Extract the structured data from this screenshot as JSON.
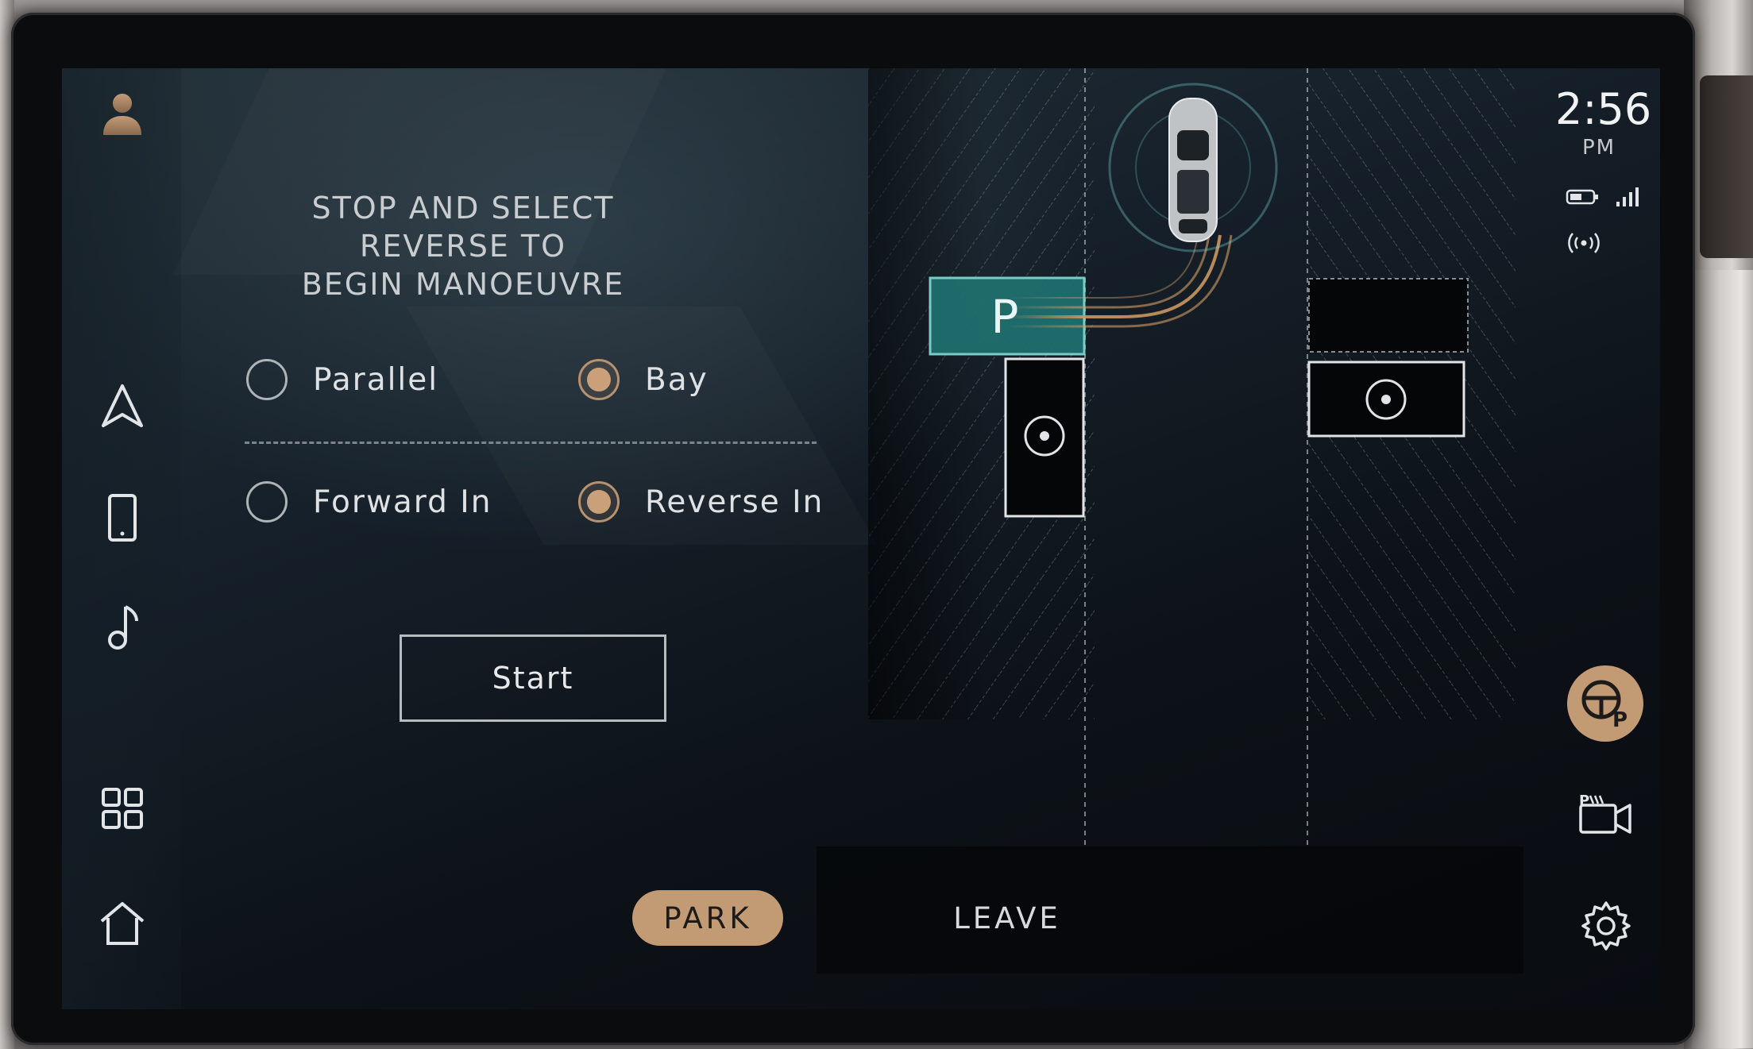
{
  "status": {
    "time": "2:56",
    "ampm": "PM"
  },
  "instruction": {
    "line1": "STOP AND SELECT REVERSE TO",
    "line2": "BEGIN MANOEUVRE"
  },
  "parking_type": {
    "options": [
      {
        "label": "Parallel",
        "selected": false
      },
      {
        "label": "Bay",
        "selected": true
      }
    ]
  },
  "approach": {
    "options": [
      {
        "label": "Forward In",
        "selected": false
      },
      {
        "label": "Reverse In",
        "selected": true
      }
    ]
  },
  "start_label": "Start",
  "tabs": {
    "park": "PARK",
    "leave": "LEAVE"
  },
  "map": {
    "target_label": "P"
  },
  "nav_icons": [
    "user-avatar-icon",
    "navigation-icon",
    "phone-icon",
    "music-icon",
    "apps-grid-icon",
    "home-icon"
  ],
  "side_icons": [
    "battery-icon",
    "signal-icon",
    "wireless-icon",
    "park-assist-icon",
    "parking-camera-icon",
    "settings-icon"
  ],
  "colors": {
    "accent": "#c29b74",
    "target_bay": "#1f6f6e",
    "path": "#c9975f"
  }
}
